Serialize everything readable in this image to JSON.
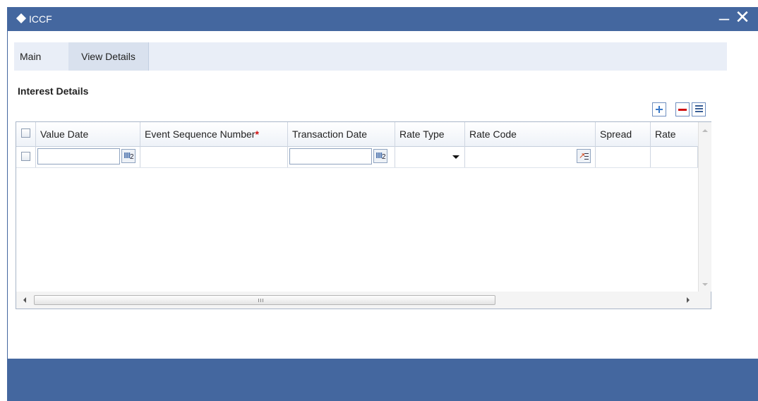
{
  "window": {
    "title": "ICCF",
    "minimize_label": "–",
    "close_label": "✕"
  },
  "tabs": [
    {
      "label": "Main",
      "active": true
    },
    {
      "label": "View Details",
      "active": false
    }
  ],
  "section": {
    "title": "Interest Details"
  },
  "toolbar": {
    "add_icon": "plus-icon",
    "remove_icon": "minus-icon",
    "detail_icon": "single-view-icon"
  },
  "table": {
    "columns": [
      {
        "label": "Value Date",
        "required": false
      },
      {
        "label": "Event Sequence Number",
        "required": true,
        "required_mark": "*"
      },
      {
        "label": "Transaction Date",
        "required": false
      },
      {
        "label": "Rate Type",
        "required": false
      },
      {
        "label": "Rate Code",
        "required": false
      },
      {
        "label": "Spread",
        "required": false
      },
      {
        "label": "Rate",
        "required": false
      }
    ],
    "rows": [
      {
        "selected": false,
        "value_date": "",
        "event_sequence_number": "",
        "transaction_date": "",
        "rate_type": "",
        "rate_code": "",
        "spread": "",
        "rate": ""
      }
    ],
    "calendar_glyph": "2",
    "scroll_grip": "III"
  },
  "colors": {
    "titlebar": "#44679f",
    "tabstrip": "#e9eef7",
    "required": "#d01010",
    "footer": "#44679f"
  }
}
